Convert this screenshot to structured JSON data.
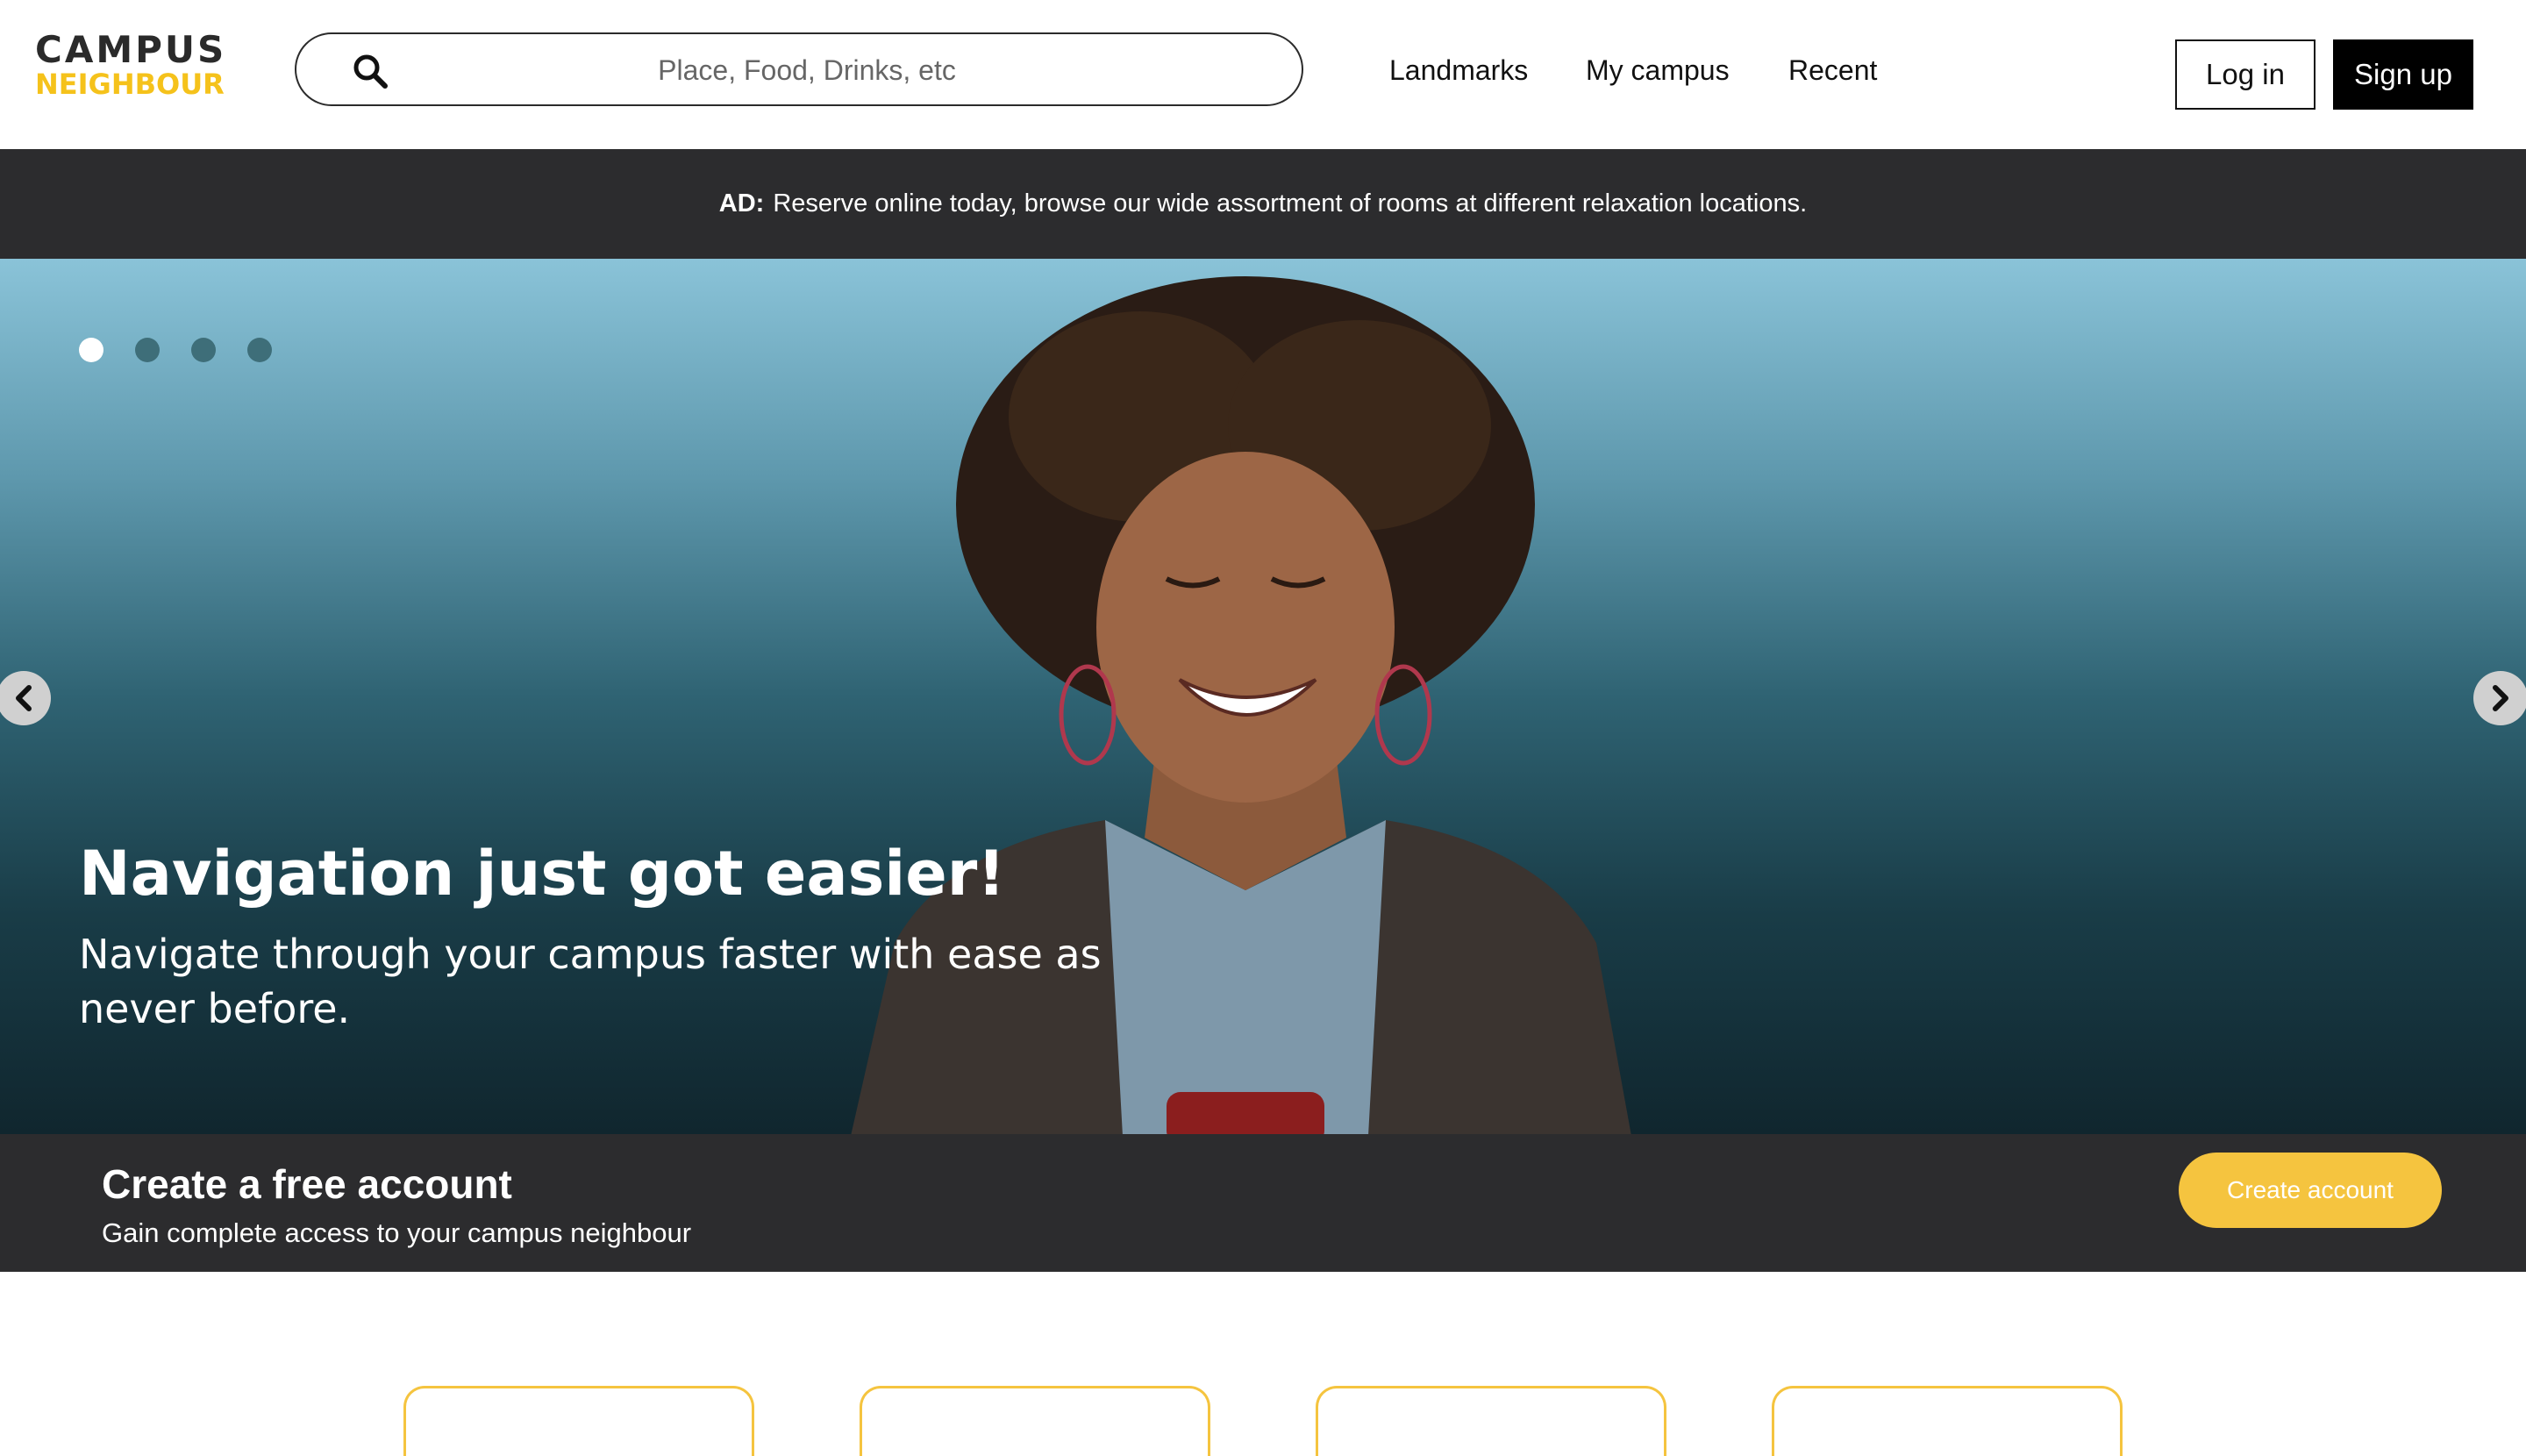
{
  "brand": {
    "line1": "CAMPUS",
    "line2": "NEIGHBOUR",
    "accent": "#f5c21b"
  },
  "search": {
    "placeholder": "Place, Food, Drinks, etc",
    "value": ""
  },
  "nav": {
    "items": [
      "Landmarks",
      "My campus",
      "Recent"
    ]
  },
  "auth": {
    "login": "Log in",
    "signup": "Sign up"
  },
  "ad": {
    "prefix": "AD:",
    "text": "Reserve online today, browse our wide assortment of rooms at different relaxation locations."
  },
  "hero": {
    "title": "Navigation just got easier!",
    "subtitle": "Navigate through your campus faster with ease as never before.",
    "slides_total": 4,
    "active_slide": 1
  },
  "cta": {
    "title": "Create a free account",
    "subtitle": "Gain complete access to your campus neighbour",
    "button": "Create account",
    "button_color": "#f5c43f"
  },
  "colors": {
    "dark_band": "#2c2c2e",
    "card_border": "#f5c43f"
  }
}
